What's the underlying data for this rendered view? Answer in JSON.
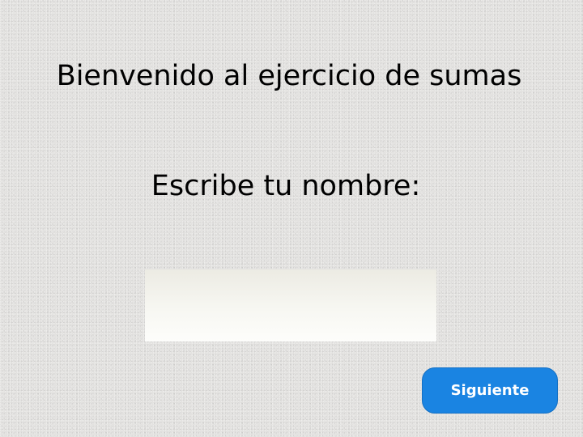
{
  "screen": {
    "title": "Bienvenido al ejercicio de sumas",
    "prompt": "Escribe tu nombre:",
    "name_input": {
      "value": "",
      "placeholder": ""
    },
    "next_button": {
      "label": "Siguiente"
    }
  },
  "colors": {
    "background": "#e3e2e0",
    "button": "#1a84e2",
    "button_text": "#ffffff",
    "text": "#000000"
  }
}
